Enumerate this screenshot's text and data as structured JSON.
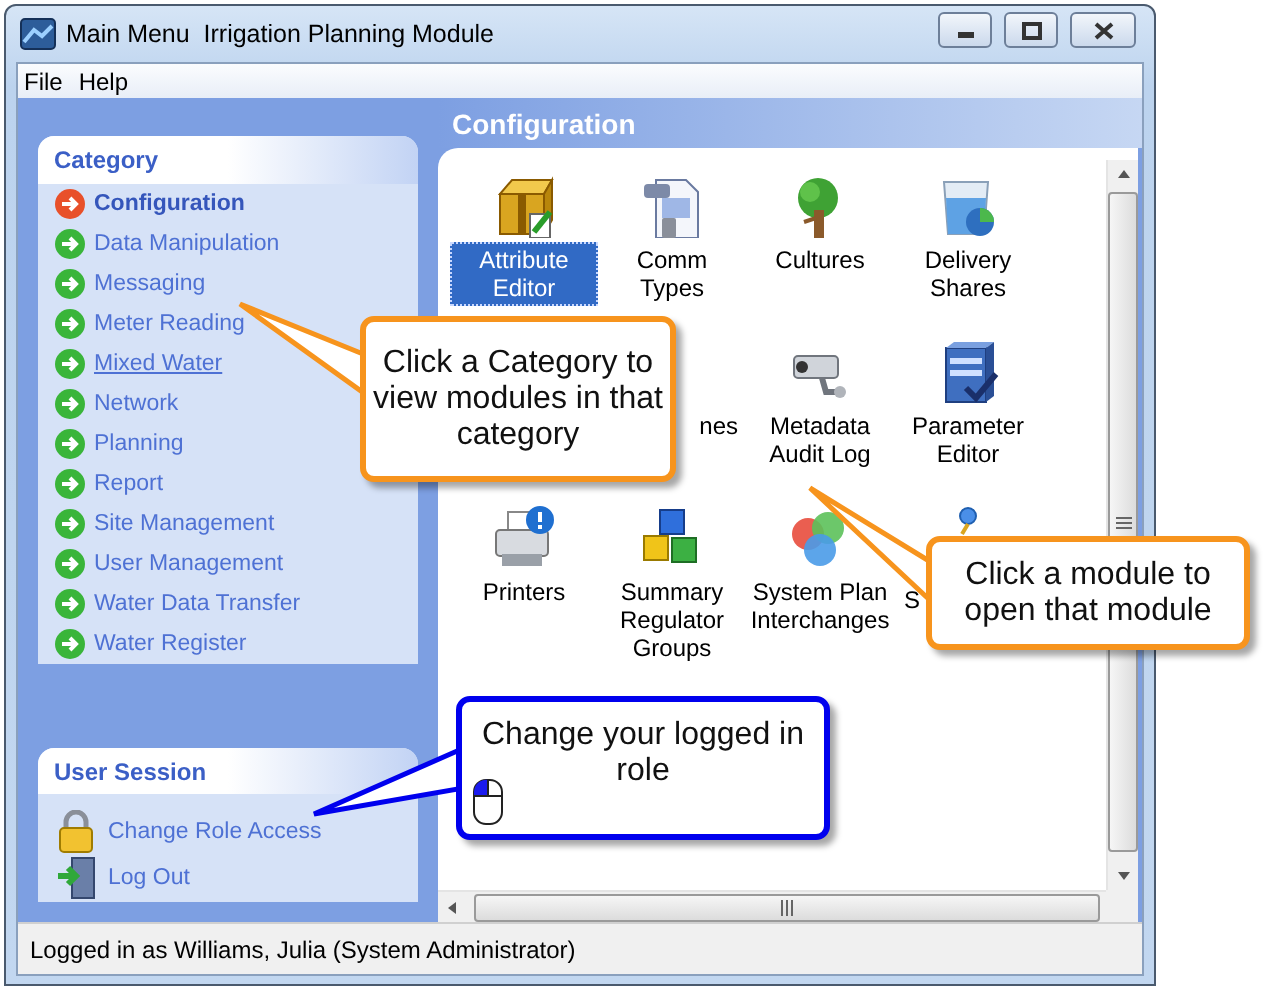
{
  "window": {
    "title": "Main Menu  Irrigation Planning Module"
  },
  "menu": [
    "File",
    "Help"
  ],
  "sidebar": {
    "category": {
      "title": "Category",
      "items": [
        {
          "label": "Configuration",
          "selected": true,
          "hovered": false
        },
        {
          "label": "Data Manipulation",
          "selected": false,
          "hovered": false
        },
        {
          "label": "Messaging",
          "selected": false,
          "hovered": false
        },
        {
          "label": "Meter Reading",
          "selected": false,
          "hovered": false
        },
        {
          "label": "Mixed Water",
          "selected": false,
          "hovered": true
        },
        {
          "label": "Network",
          "selected": false,
          "hovered": false
        },
        {
          "label": "Planning",
          "selected": false,
          "hovered": false
        },
        {
          "label": "Report",
          "selected": false,
          "hovered": false
        },
        {
          "label": "Site Management",
          "selected": false,
          "hovered": false
        },
        {
          "label": "User Management",
          "selected": false,
          "hovered": false
        },
        {
          "label": "Water Data Transfer",
          "selected": false,
          "hovered": false
        },
        {
          "label": "Water Register",
          "selected": false,
          "hovered": false
        }
      ]
    },
    "user_session": {
      "title": "User Session",
      "items": [
        {
          "label": "Change Role Access"
        },
        {
          "label": "Log Out"
        }
      ]
    }
  },
  "content": {
    "title": "Configuration",
    "module_rows": [
      [
        {
          "label": "Attribute Editor",
          "kind": "full",
          "selected": true
        },
        {
          "label": "Comm Types",
          "kind": "full",
          "selected": false
        },
        {
          "label": "Cultures",
          "kind": "full",
          "selected": false
        },
        {
          "label": "Delivery Shares",
          "kind": "full",
          "selected": false
        }
      ],
      [
        {
          "label": "nes",
          "kind": "tail",
          "selected": false
        },
        {
          "label": "Metadata Audit Log",
          "kind": "full",
          "selected": false
        },
        {
          "label": "Parameter Editor",
          "kind": "full",
          "selected": false
        }
      ],
      [
        {
          "label": "Printers",
          "kind": "full",
          "selected": false
        },
        {
          "label": "Summary Regulator Groups",
          "kind": "full",
          "selected": false
        },
        {
          "label": "System Plan Interchanges",
          "kind": "full",
          "selected": false
        },
        {
          "label": "S",
          "kind": "head",
          "selected": false
        }
      ]
    ]
  },
  "status_bar": "Logged in as Williams, Julia (System Administrator)",
  "callouts": [
    {
      "text": "Click a Category to view modules in that category",
      "color": "#f7941d",
      "kind": "plain"
    },
    {
      "text": "Click a module to open that module",
      "color": "#f7941d",
      "kind": "plain"
    },
    {
      "text": "Change your logged in role",
      "color": "#0000ee",
      "kind": "mouse"
    }
  ]
}
